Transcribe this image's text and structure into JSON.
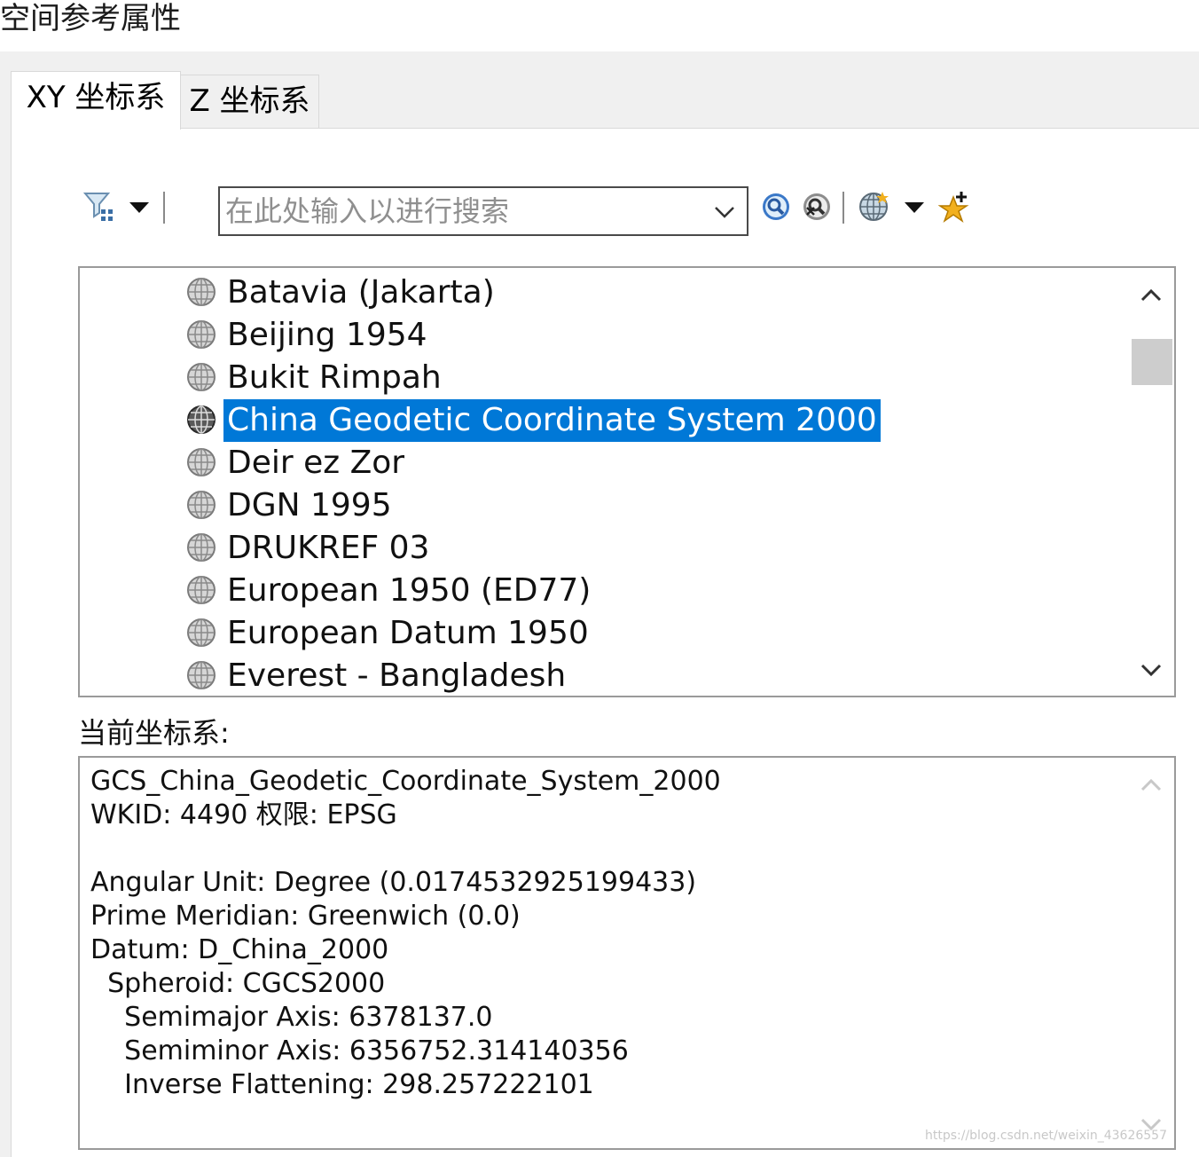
{
  "window": {
    "title": "空间参考属性"
  },
  "tabs": [
    {
      "label": "XY 坐标系",
      "active": true
    },
    {
      "label": "Z 坐标系",
      "active": false
    }
  ],
  "toolbar": {
    "search_placeholder": "在此处输入以进行搜索",
    "icons": [
      "filter-icon",
      "dropdown-arrow-icon",
      "search-icon",
      "clear-search-icon",
      "globe-icon",
      "dropdown-arrow-icon",
      "add-favorite-icon"
    ]
  },
  "coordinate_list": {
    "items": [
      {
        "label": "Batavia (Jakarta)",
        "selected": false
      },
      {
        "label": "Beijing 1954",
        "selected": false
      },
      {
        "label": "Bukit Rimpah",
        "selected": false
      },
      {
        "label": "China Geodetic Coordinate System 2000",
        "selected": true
      },
      {
        "label": "Deir ez Zor",
        "selected": false
      },
      {
        "label": "DGN 1995",
        "selected": false
      },
      {
        "label": "DRUKREF 03",
        "selected": false
      },
      {
        "label": "European 1950 (ED77)",
        "selected": false
      },
      {
        "label": "European Datum 1950",
        "selected": false
      },
      {
        "label": "Everest - Bangladesh",
        "selected": false
      }
    ],
    "selection_color": "#0078d7"
  },
  "current": {
    "label": "当前坐标系:",
    "lines": [
      "GCS_China_Geodetic_Coordinate_System_2000",
      "WKID: 4490 权限: EPSG",
      "",
      "Angular Unit: Degree (0.0174532925199433)",
      "Prime Meridian: Greenwich (0.0)",
      "Datum: D_China_2000",
      "  Spheroid: CGCS2000",
      "    Semimajor Axis: 6378137.0",
      "    Semiminor Axis: 6356752.314140356",
      "    Inverse Flattening: 298.257222101"
    ]
  },
  "watermark": "https://blog.csdn.net/weixin_43626557"
}
